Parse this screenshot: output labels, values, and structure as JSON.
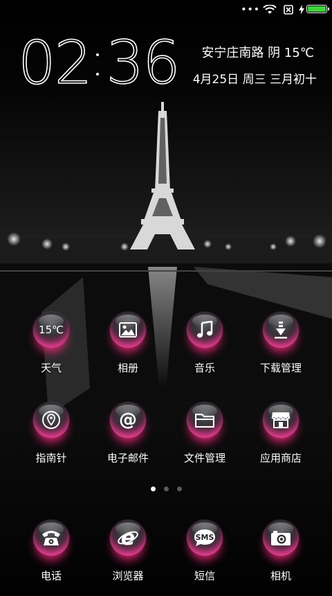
{
  "status_bar": {
    "more": "•••",
    "battery_level": 1.0,
    "battery_color": "#3fd13a"
  },
  "clock": {
    "hh": "02",
    "mm": "36"
  },
  "weather_line": "安宁庄南路 阴 15℃",
  "date_line": "4月25日 周三 三月初十",
  "apps": [
    {
      "label": "天气",
      "icon": "weather-icon",
      "icon_text": "15℃"
    },
    {
      "label": "相册",
      "icon": "gallery-icon"
    },
    {
      "label": "音乐",
      "icon": "music-note-icon"
    },
    {
      "label": "下载管理",
      "icon": "download-icon"
    },
    {
      "label": "指南针",
      "icon": "compass-icon"
    },
    {
      "label": "电子邮件",
      "icon": "at-sign-icon",
      "icon_text": "@"
    },
    {
      "label": "文件管理",
      "icon": "folder-icon"
    },
    {
      "label": "应用商店",
      "icon": "store-icon"
    }
  ],
  "pager": {
    "pages": 3,
    "current": 1
  },
  "dock": [
    {
      "label": "电话",
      "icon": "phone-icon"
    },
    {
      "label": "浏览器",
      "icon": "browser-icon",
      "icon_text": "e"
    },
    {
      "label": "短信",
      "icon": "sms-icon",
      "icon_text": "SMS"
    },
    {
      "label": "相机",
      "icon": "camera-icon"
    }
  ],
  "colors": {
    "accent_pink": "#ff3c96",
    "background": "#000000"
  }
}
